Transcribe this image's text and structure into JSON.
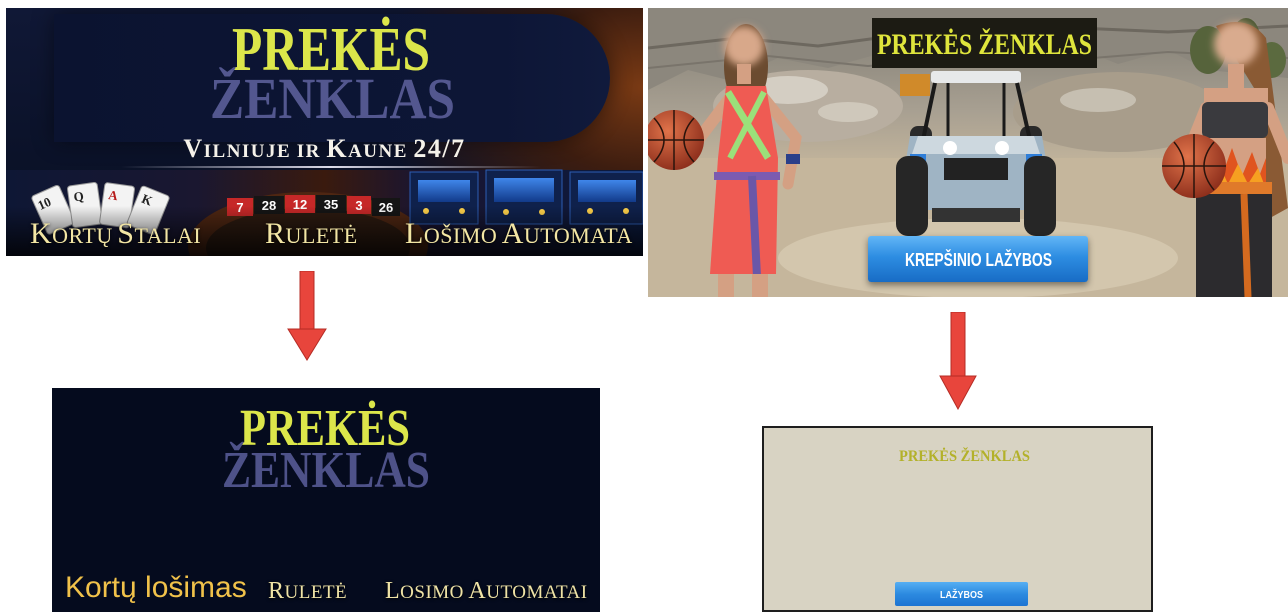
{
  "casino_banner_original": {
    "brand_line1": "PREKĖS",
    "brand_line2": "ŽENKLAS",
    "tagline": "VILNIUJE IR KAUNE 24/7",
    "card_ranks": [
      "10",
      "Q",
      "A",
      "K"
    ],
    "roulette_numbers": [
      "7",
      "28",
      "12",
      "35",
      "3",
      "26"
    ],
    "categories": [
      "KORTŲ STALAI",
      "RULETĖ",
      "LOŠIMO AUTOMATA"
    ]
  },
  "casino_banner_revised": {
    "brand_line1": "PREKĖS",
    "brand_line2": "ŽENKLAS",
    "categories": [
      "Kortų lošimas",
      "RULETĖ",
      "LOSIMO AUTOMATAI"
    ]
  },
  "sports_banner_original": {
    "brand": "PREKĖS ŽENKLAS",
    "button_label": "KREPŠINIO LAŽYBOS"
  },
  "sports_banner_revised": {
    "brand": "PREKĖS ŽENKLAS",
    "button_label": "LAŽYBOS"
  },
  "arrows": [
    {
      "icon": "arrow-down-icon",
      "color": "#e8453c"
    },
    {
      "icon": "arrow-down-icon",
      "color": "#e8453c"
    }
  ],
  "colors": {
    "brand_yellow": "#dce64a",
    "brand_purple": "#53578f",
    "category_gold": "#f3e6a4",
    "revised_category_gold": "#f1c24a",
    "button_blue": "#2a86dc",
    "revised_background": "#d8d3c3",
    "dark_navy": "#050b1e"
  }
}
